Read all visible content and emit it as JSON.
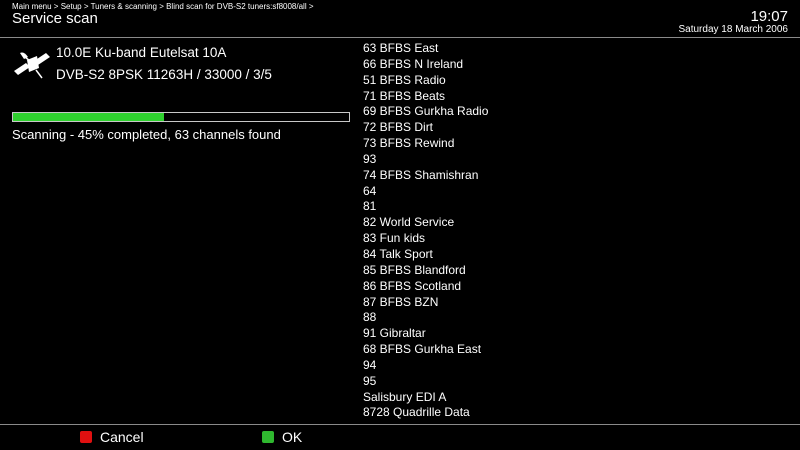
{
  "header": {
    "breadcrumb": "Main menu > Setup > Tuners & scanning > Blind scan for DVB-S2 tuners:sf8008/all >",
    "title": "Service scan",
    "time": "19:07",
    "date": "Saturday 18 March 2006"
  },
  "scan": {
    "satellite": "10.0E Ku-band Eutelsat 10A",
    "transponder": "DVB-S2 8PSK 11263H / 33000 / 3/5",
    "progress_percent": 45,
    "status": "Scanning - 45% completed, 63 channels found",
    "icon": "satellite-icon"
  },
  "channels": [
    "63 BFBS East",
    "66 BFBS N Ireland",
    "51 BFBS Radio",
    "71 BFBS Beats",
    "69 BFBS Gurkha Radio",
    "72 BFBS Dirt",
    "73 BFBS Rewind",
    "93",
    "74 BFBS Shamishran",
    "64",
    "81",
    "82 World Service",
    "83 Fun kids",
    "84 Talk Sport",
    "85 BFBS Blandford",
    "86 BFBS Scotland",
    "87 BFBS BZN",
    "88",
    "91 Gibraltar",
    "68 BFBS Gurkha East",
    "94",
    "95",
    "Salisbury EDI A",
    "8728 Quadrille Data"
  ],
  "footer": {
    "cancel_label": "Cancel",
    "ok_label": "OK"
  },
  "colors": {
    "background": "#000000",
    "progress_fill": "#2fd12f",
    "cancel_key": "#e01010",
    "ok_key": "#2fb82f"
  }
}
